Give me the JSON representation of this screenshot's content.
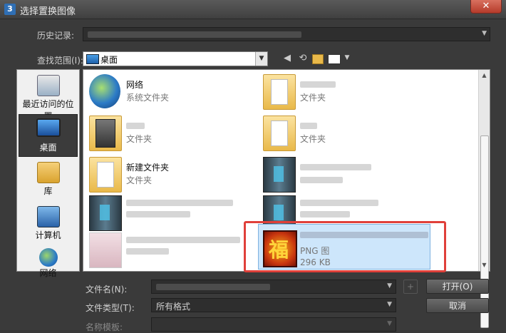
{
  "window": {
    "title": "选择置换图像",
    "app_icon": "3",
    "close_label": "✕"
  },
  "history": {
    "label": "历史记录:"
  },
  "lookin": {
    "label": "查找范围(I):",
    "value": "桌面"
  },
  "places": [
    {
      "label": "最近访问的位置",
      "icon": "recent-places-icon"
    },
    {
      "label": "桌面",
      "icon": "desktop-icon",
      "selected": true
    },
    {
      "label": "库",
      "icon": "library-icon"
    },
    {
      "label": "计算机",
      "icon": "computer-icon"
    },
    {
      "label": "网络",
      "icon": "network-icon"
    }
  ],
  "files": {
    "network": {
      "name": "网络",
      "type": "系统文件夹"
    },
    "folder1_type": "文件夹",
    "folder2_type": "文件夹",
    "folder3_type": "文件夹",
    "new_folder": {
      "name": "新建文件夹",
      "type": "文件夹"
    },
    "selected_png": {
      "type": "PNG 图",
      "size": "296 KB"
    }
  },
  "bottom": {
    "filename_label": "文件名(N):",
    "filetype_label": "文件类型(T):",
    "filetype_value": "所有格式",
    "template_label": "名称模板:",
    "plus_label": "+",
    "open_button": "打开(O)",
    "cancel_button": "取消"
  },
  "colors": {
    "highlight_box": "#e0403a",
    "selection": "#cde6fb"
  }
}
